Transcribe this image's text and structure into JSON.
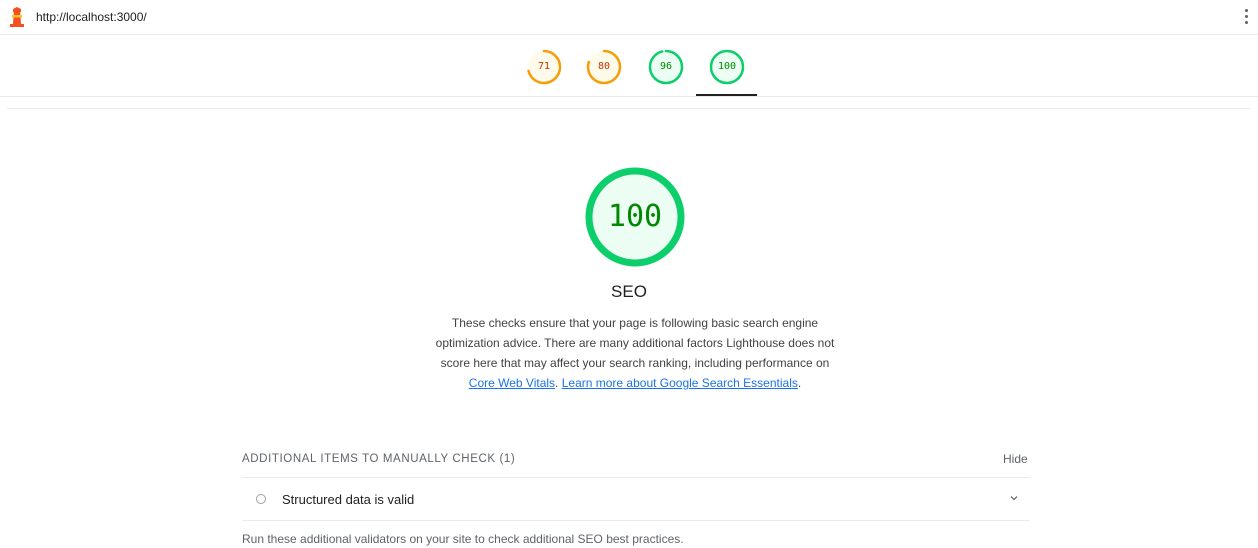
{
  "header": {
    "url": "http://localhost:3000/"
  },
  "score_tabs": [
    {
      "score": "71",
      "color": "#f59e0b",
      "text_color": "#c33300",
      "fraction": 0.71
    },
    {
      "score": "80",
      "color": "#f59e0b",
      "text_color": "#c33300",
      "fraction": 0.8
    },
    {
      "score": "96",
      "color": "#0cce6b",
      "text_color": "#008800",
      "fraction": 0.96
    },
    {
      "score": "100",
      "color": "#0cce6b",
      "text_color": "#008800",
      "fraction": 1.0
    }
  ],
  "category": {
    "score": "100",
    "score_fraction": 1.0,
    "title": "SEO",
    "description": "These checks ensure that your page is following basic search engine optimization advice. There are many additional factors Lighthouse does not score here that may affect your search ranking, including performance on",
    "link_core_web_vitals": "Core Web Vitals",
    "separator": ". ",
    "link_learn_more": "Learn more about Google Search Essentials",
    "end": "."
  },
  "manual_checks": {
    "heading": "ADDITIONAL ITEMS TO MANUALLY CHECK (1)",
    "hide_label": "Hide",
    "items": [
      {
        "title": "Structured data is valid"
      }
    ],
    "note": "Run these additional validators on your site to check additional SEO best practices."
  },
  "colors": {
    "pass": "#0cce6b",
    "average": "#f59e0b",
    "link": "#1a73e8"
  }
}
